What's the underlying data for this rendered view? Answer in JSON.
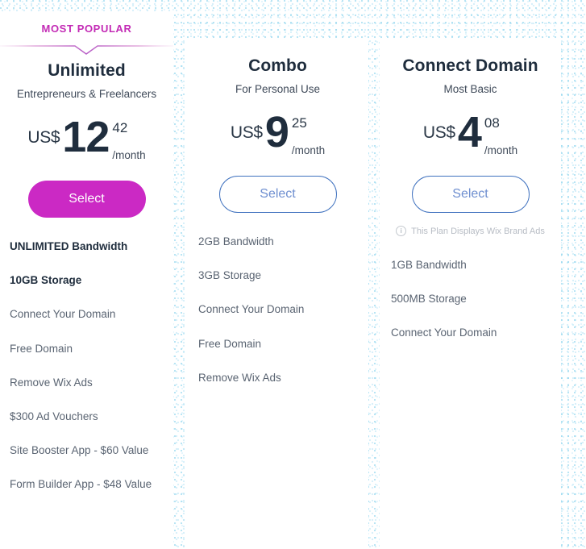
{
  "theme": {
    "accent_magenta": "#cb29c4",
    "accent_blue": "#4072bf",
    "text_dark": "#1f2d3d",
    "text_grey": "#5a6472",
    "badge_color": "#c32bb5",
    "background_speckle": "#78cdeb"
  },
  "plans": [
    {
      "badge": "MOST POPULAR",
      "featured": true,
      "name": "Unlimited",
      "subtitle": "Entrepreneurs & Freelancers",
      "currency": "US$",
      "amount": "12",
      "cents": "42",
      "period": "/month",
      "button_label": "Select",
      "button_style": "primary",
      "ads_note": null,
      "ads_icon": "info-icon",
      "features": [
        {
          "label": "UNLIMITED Bandwidth",
          "emphasis": true
        },
        {
          "label": "10GB Storage",
          "emphasis": true
        },
        {
          "label": "Connect Your Domain",
          "emphasis": false
        },
        {
          "label": "Free Domain",
          "emphasis": false
        },
        {
          "label": "Remove Wix Ads",
          "emphasis": false
        },
        {
          "label": "$300 Ad Vouchers",
          "emphasis": false
        },
        {
          "label": "Site Booster App - $60 Value",
          "emphasis": false
        },
        {
          "label": "Form Builder App - $48 Value",
          "emphasis": false
        }
      ]
    },
    {
      "badge": null,
      "featured": false,
      "name": "Combo",
      "subtitle": "For Personal Use",
      "currency": "US$",
      "amount": "9",
      "cents": "25",
      "period": "/month",
      "button_label": "Select",
      "button_style": "outline",
      "ads_note": null,
      "ads_icon": "info-icon",
      "features": [
        {
          "label": "2GB Bandwidth",
          "emphasis": false
        },
        {
          "label": "3GB Storage",
          "emphasis": false
        },
        {
          "label": "Connect Your Domain",
          "emphasis": false
        },
        {
          "label": "Free Domain",
          "emphasis": false
        },
        {
          "label": "Remove Wix Ads",
          "emphasis": false
        }
      ]
    },
    {
      "badge": null,
      "featured": false,
      "name": "Connect Domain",
      "subtitle": "Most Basic",
      "currency": "US$",
      "amount": "4",
      "cents": "08",
      "period": "/month",
      "button_label": "Select",
      "button_style": "outline",
      "ads_note": "This Plan Displays Wix Brand Ads",
      "ads_icon": "info-icon",
      "features": [
        {
          "label": "1GB Bandwidth",
          "emphasis": false
        },
        {
          "label": "500MB Storage",
          "emphasis": false
        },
        {
          "label": "Connect Your Domain",
          "emphasis": false
        }
      ]
    }
  ]
}
